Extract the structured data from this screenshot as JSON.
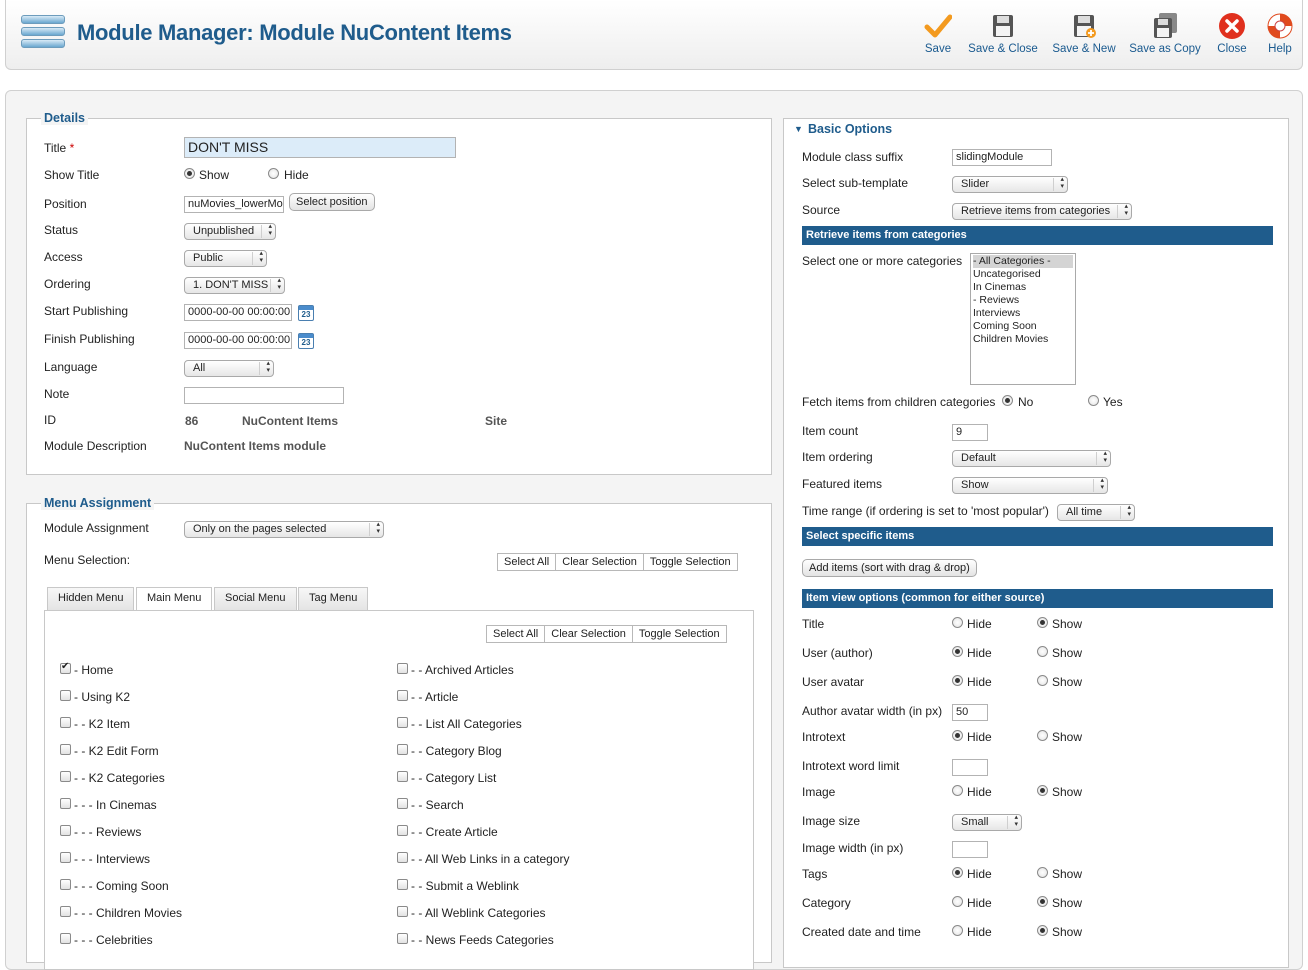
{
  "header": {
    "title": "Module Manager: Module NuContent Items"
  },
  "toolbar": [
    {
      "name": "save-button",
      "icon": "checkmark-icon",
      "label": "Save"
    },
    {
      "name": "save-close-button",
      "icon": "floppy-icon",
      "label": "Save & Close"
    },
    {
      "name": "save-new-button",
      "icon": "floppy-plus-icon",
      "label": "Save & New"
    },
    {
      "name": "save-copy-button",
      "icon": "floppy-copy-icon",
      "label": "Save as Copy"
    },
    {
      "name": "close-button",
      "icon": "close-icon",
      "label": "Close"
    },
    {
      "name": "help-button",
      "icon": "lifebuoy-icon",
      "label": "Help"
    }
  ],
  "details": {
    "legend": "Details",
    "title_label": "Title",
    "required_mark": "*",
    "title_value": "DON'T MISS",
    "show_title_label": "Show Title",
    "show_title_options": [
      "Show",
      "Hide"
    ],
    "position_label": "Position",
    "position_value": "nuMovies_lowerModule",
    "select_position_button": "Select position",
    "status_label": "Status",
    "status_value": "Unpublished",
    "access_label": "Access",
    "access_value": "Public",
    "ordering_label": "Ordering",
    "ordering_value": "1. DON'T MISS",
    "start_publishing_label": "Start Publishing",
    "start_publishing_value": "0000-00-00 00:00:00",
    "finish_publishing_label": "Finish Publishing",
    "finish_publishing_value": "0000-00-00 00:00:00",
    "calendar_day": "23",
    "language_label": "Language",
    "language_value": "All",
    "note_label": "Note",
    "note_value": "",
    "id_label": "ID",
    "id_value": "86",
    "module_type": "NuContent Items",
    "module_site": "Site",
    "description_label": "Module Description",
    "description_value": "NuContent Items module"
  },
  "menu_assignment": {
    "legend": "Menu Assignment",
    "assignment_label": "Module Assignment",
    "assignment_value": "Only on the pages selected",
    "selection_label": "Menu Selection:",
    "buttons": [
      "Select All",
      "Clear Selection",
      "Toggle Selection"
    ],
    "tabs": [
      "Hidden Menu",
      "Main Menu",
      "Social Menu",
      "Tag Menu"
    ],
    "left_items": [
      {
        "label": "- Home",
        "checked": true
      },
      {
        "label": "- Using K2",
        "checked": false
      },
      {
        "label": "- - K2 Item",
        "checked": false
      },
      {
        "label": "- - K2 Edit Form",
        "checked": false
      },
      {
        "label": "- - K2 Categories",
        "checked": false
      },
      {
        "label": "- - - In Cinemas",
        "checked": false
      },
      {
        "label": "- - - Reviews",
        "checked": false
      },
      {
        "label": "- - - Interviews",
        "checked": false
      },
      {
        "label": "- - - Coming Soon",
        "checked": false
      },
      {
        "label": "- - - Children Movies",
        "checked": false
      },
      {
        "label": "- - - Celebrities",
        "checked": false
      }
    ],
    "right_items": [
      {
        "label": "- - Archived Articles",
        "checked": false
      },
      {
        "label": "- - Article",
        "checked": false
      },
      {
        "label": "- - List All Categories",
        "checked": false
      },
      {
        "label": "- - Category Blog",
        "checked": false
      },
      {
        "label": "- - Category List",
        "checked": false
      },
      {
        "label": "- - Search",
        "checked": false
      },
      {
        "label": "- - Create Article",
        "checked": false
      },
      {
        "label": "- - All Web Links in a category",
        "checked": false
      },
      {
        "label": "- - Submit a Weblink",
        "checked": false
      },
      {
        "label": "- - All Weblink Categories",
        "checked": false
      },
      {
        "label": "- - News Feeds Categories",
        "checked": false
      }
    ]
  },
  "basic": {
    "header": "Basic Options",
    "class_suffix_label": "Module class suffix",
    "class_suffix_value": "slidingModule",
    "subtemplate_label": "Select sub-template",
    "subtemplate_value": "Slider",
    "source_label": "Source",
    "source_value": "Retrieve items from categories",
    "section_categories": "Retrieve items from categories",
    "categories_label": "Select one or more categories",
    "categories": [
      "- All Categories -",
      "Uncategorised",
      "In Cinemas",
      "- Reviews",
      "Interviews",
      "Coming Soon",
      "Children Movies"
    ],
    "fetch_children_label": "Fetch items from children categories",
    "fetch_children_options": [
      "No",
      "Yes"
    ],
    "item_count_label": "Item count",
    "item_count_value": "9",
    "item_ordering_label": "Item ordering",
    "item_ordering_value": "Default",
    "featured_label": "Featured items",
    "featured_value": "Show",
    "time_range_label": "Time range (if ordering is set to 'most popular')",
    "time_range_value": "All time",
    "section_specific": "Select specific items",
    "add_items_button": "Add items (sort with drag & drop)",
    "section_view": "Item view options (common for either source)",
    "hide_label": "Hide",
    "show_label": "Show",
    "options": [
      {
        "label": "Title",
        "type": "radio",
        "selected": "Show"
      },
      {
        "label": "User (author)",
        "type": "radio",
        "selected": "Hide"
      },
      {
        "label": "User avatar",
        "type": "radio",
        "selected": "Hide"
      },
      {
        "label": "Author avatar width (in px)",
        "type": "text",
        "value": "50"
      },
      {
        "label": "Introtext",
        "type": "radio",
        "selected": "Hide"
      },
      {
        "label": "Introtext word limit",
        "type": "text",
        "value": ""
      },
      {
        "label": "Image",
        "type": "radio",
        "selected": "Show"
      },
      {
        "label": "Image size",
        "type": "select",
        "value": "Small"
      },
      {
        "label": "Image width (in px)",
        "type": "text",
        "value": ""
      },
      {
        "label": "Tags",
        "type": "radio",
        "selected": "Hide"
      },
      {
        "label": "Category",
        "type": "radio",
        "selected": "Show"
      },
      {
        "label": "Created date and time",
        "type": "radio",
        "selected": "Show"
      }
    ]
  }
}
